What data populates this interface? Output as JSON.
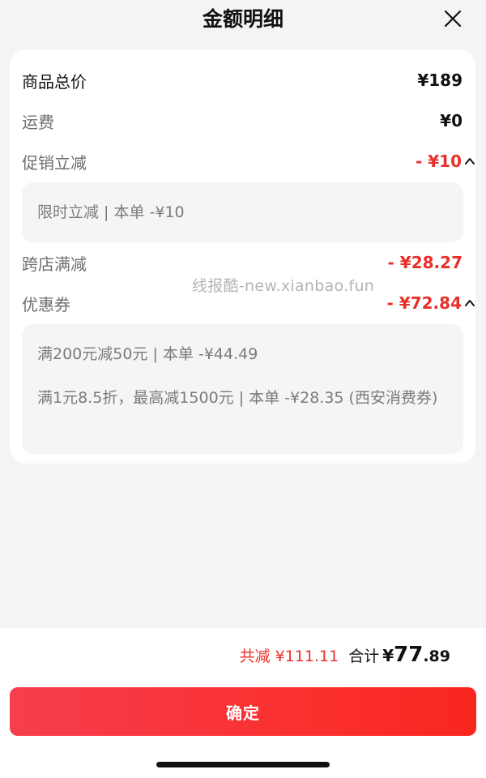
{
  "header": {
    "title": "金额明细"
  },
  "rows": [
    {
      "label": "商品总价",
      "value": "¥189"
    },
    {
      "label": "运费",
      "value": "¥0"
    },
    {
      "label": "促销立减",
      "value": "- ¥10"
    },
    {
      "label": "跨店满减",
      "value": "- ¥28.27"
    },
    {
      "label": "优惠券",
      "value": "- ¥72.84"
    }
  ],
  "promo_details": [
    "限时立减 | 本单 -¥10"
  ],
  "coupon_details": [
    "满200元减50元 | 本单 -¥44.49",
    "满1元8.5折，最高减1500元 | 本单 -¥28.35 (西安消费券)"
  ],
  "watermark": "线报酷-new.xianbao.fun",
  "footer": {
    "reduce_text": "共减 ¥111.11",
    "total_label": "合计",
    "currency": "¥",
    "total_int": "77",
    "total_dec": ".89",
    "confirm_label": "确定"
  },
  "colors": {
    "accent_red": "#e8302a",
    "button_start": "#f63e4e",
    "button_end": "#f8271f"
  },
  "icons": {
    "close": "close-icon",
    "collapse": "chevron-up-icon"
  }
}
